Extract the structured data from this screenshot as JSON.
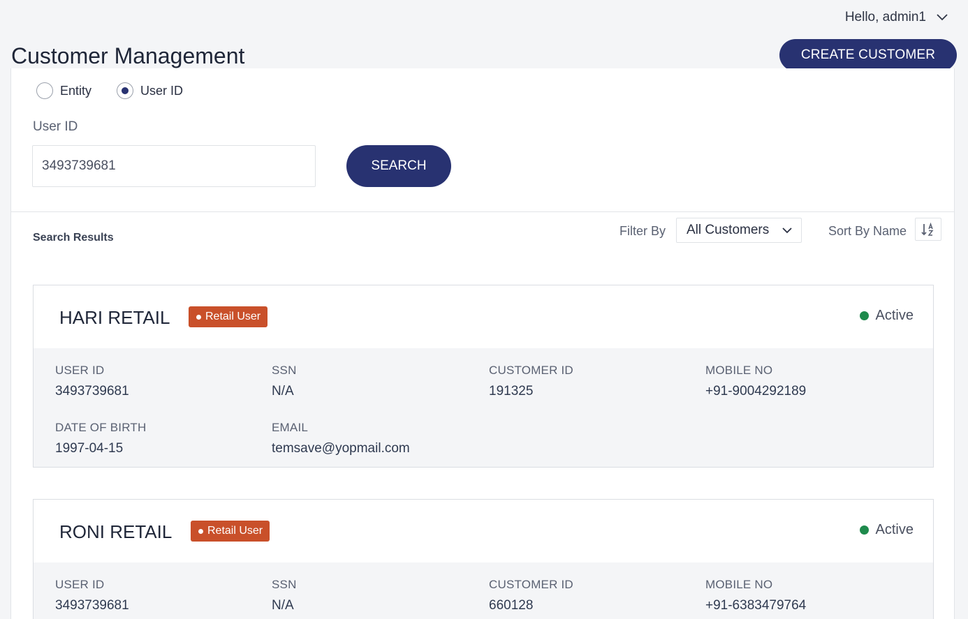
{
  "header": {
    "greeting": "Hello, admin1",
    "page_title": "Customer Management",
    "create_button": "CREATE CUSTOMER"
  },
  "search": {
    "options": [
      {
        "label": "Entity",
        "checked": false
      },
      {
        "label": "User ID",
        "checked": true
      }
    ],
    "field_label": "User ID",
    "value": "3493739681",
    "button": "SEARCH"
  },
  "results": {
    "label": "Search Results",
    "filter_label": "Filter By",
    "filter_value": "All Customers",
    "sort_label": "Sort By Name"
  },
  "labels": {
    "user_id": "USER ID",
    "ssn": "SSN",
    "customer_id": "CUSTOMER ID",
    "mobile": "MOBILE NO",
    "dob": "DATE OF BIRTH",
    "email": "EMAIL"
  },
  "customers": [
    {
      "name": "HARI RETAIL",
      "badge": "Retail User",
      "status": "Active",
      "user_id": "3493739681",
      "ssn": "N/A",
      "customer_id": "191325",
      "mobile": "+91-9004292189",
      "dob": "1997-04-15",
      "email": "temsave@yopmail.com"
    },
    {
      "name": "RONI RETAIL",
      "badge": "Retail User",
      "status": "Active",
      "user_id": "3493739681",
      "ssn": "N/A",
      "customer_id": "660128",
      "mobile": "+91-6383479764"
    }
  ],
  "colors": {
    "primary": "#283271",
    "badge": "#c9502a",
    "active": "#1e8a4c"
  }
}
